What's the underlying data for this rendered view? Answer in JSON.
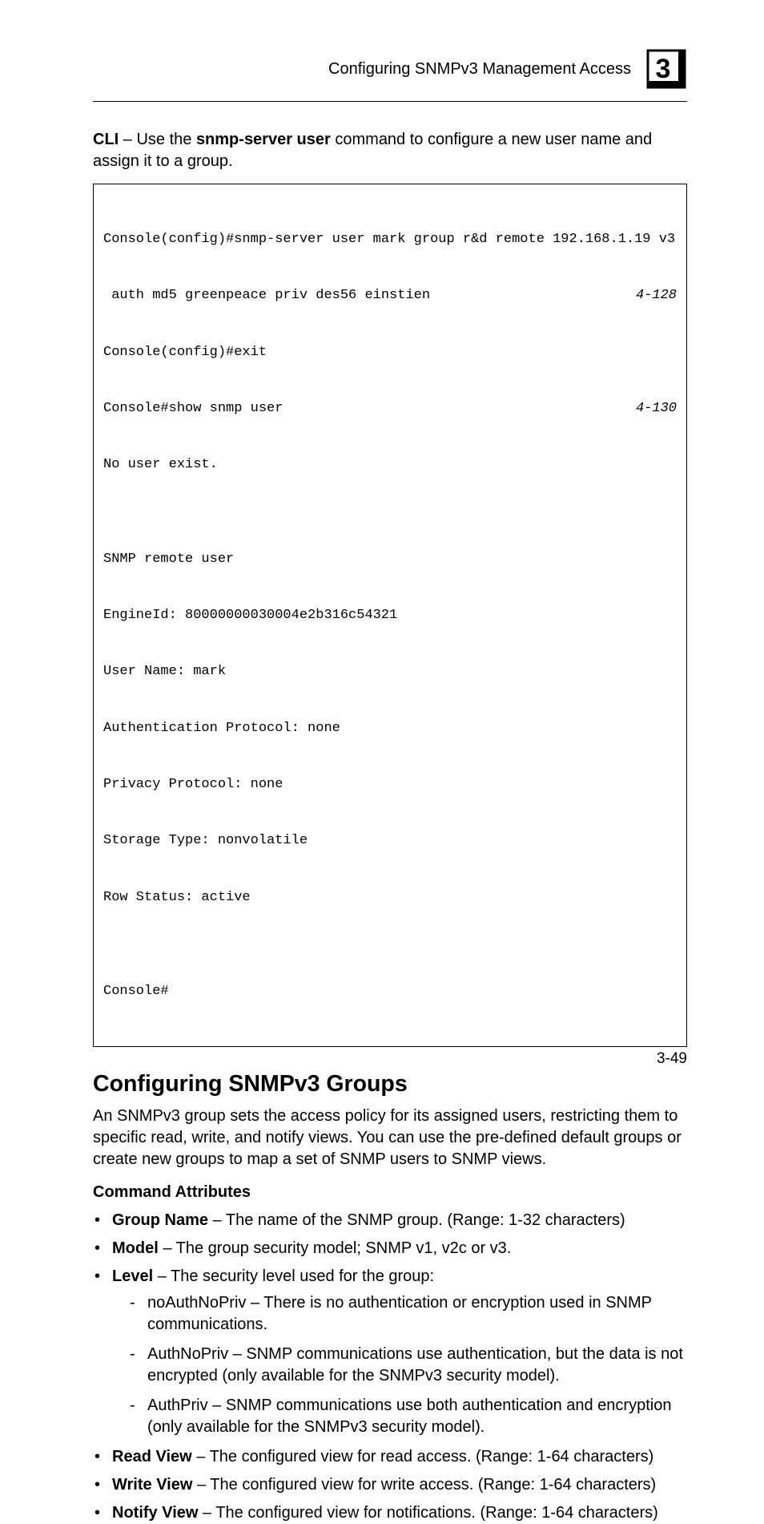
{
  "header": {
    "running_title": "Configuring SNMPv3 Management Access",
    "chapter_number": "3"
  },
  "intro": {
    "pre_bold": "CLI",
    "mid1": " – Use the ",
    "cmd_bold": "snmp-server user",
    "mid2": " command to configure a new user name and assign it to a group."
  },
  "code": {
    "lines": [
      {
        "left": "Console(config)#snmp-server user mark group r&d remote 192.168.1.19 v3",
        "right": ""
      },
      {
        "left": " auth md5 greenpeace priv des56 einstien",
        "right": "4-128"
      },
      {
        "left": "Console(config)#exit",
        "right": ""
      },
      {
        "left": "Console#show snmp user",
        "right": "4-130"
      },
      {
        "left": "No user exist.",
        "right": ""
      },
      {
        "left": "",
        "right": ""
      },
      {
        "left": "SNMP remote user",
        "right": ""
      },
      {
        "left": "EngineId: 80000000030004e2b316c54321",
        "right": ""
      },
      {
        "left": "User Name: mark",
        "right": ""
      },
      {
        "left": "Authentication Protocol: none",
        "right": ""
      },
      {
        "left": "Privacy Protocol: none",
        "right": ""
      },
      {
        "left": "Storage Type: nonvolatile",
        "right": ""
      },
      {
        "left": "Row Status: active",
        "right": ""
      },
      {
        "left": "",
        "right": ""
      },
      {
        "left": "Console#",
        "right": ""
      }
    ]
  },
  "section": {
    "title": "Configuring SNMPv3 Groups",
    "para": "An SNMPv3 group sets the access policy for its assigned users, restricting them to specific read, write, and notify views. You can use the pre-defined default groups or create new groups to map a set of SNMP users to SNMP views."
  },
  "cmd_attr_heading": "Command Attributes",
  "bullets": {
    "group_name_label": "Group Name",
    "group_name_text": " – The name of the SNMP group. (Range: 1-32 characters)",
    "model_label": "Model",
    "model_text": " – The group security model; SNMP v1, v2c or v3.",
    "level_label": "Level",
    "level_text": " – The security level used for the group:",
    "sub": [
      "noAuthNoPriv – There is no authentication or encryption used in SNMP communications.",
      "AuthNoPriv – SNMP communications use authentication, but the data is not encrypted (only available for the SNMPv3 security model).",
      "AuthPriv – SNMP communications use both authentication and encryption (only available for the SNMPv3 security model)."
    ],
    "read_label": "Read View",
    "read_text": " – The configured view for read access. (Range: 1-64 characters)",
    "write_label": "Write View",
    "write_text": " – The configured view for write access. (Range: 1-64 characters)",
    "notify_label": "Notify View",
    "notify_text": " – The configured view for notifications. (Range: 1-64 characters)"
  },
  "page_number": "3-49"
}
